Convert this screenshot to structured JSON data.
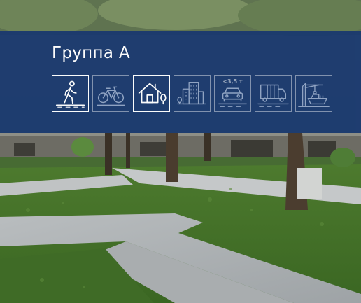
{
  "panel": {
    "title": "Группа А",
    "icons": [
      {
        "name": "pedestrian-icon",
        "active": true
      },
      {
        "name": "bicycle-icon",
        "active": false
      },
      {
        "name": "house-icon",
        "active": true
      },
      {
        "name": "city-buildings-icon",
        "active": false
      },
      {
        "name": "car-icon",
        "active": false,
        "badge": "<3,5 т"
      },
      {
        "name": "truck-icon",
        "active": false
      },
      {
        "name": "port-crane-icon",
        "active": false
      }
    ]
  },
  "colors": {
    "panel_bg": "#1b3a6e",
    "icon_active": "#ffffff",
    "icon_inactive": "#8fa3c4"
  }
}
